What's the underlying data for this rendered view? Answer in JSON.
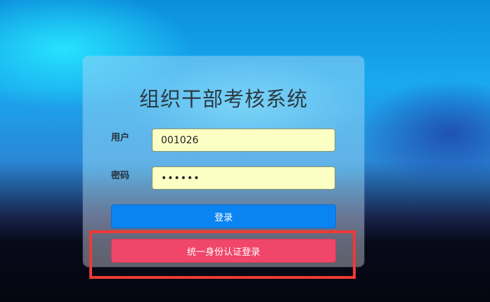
{
  "login": {
    "title": "组织干部考核系统",
    "username_label": "用户",
    "username_value": "001026",
    "password_label": "密码",
    "password_value": "123456",
    "login_button": "登录",
    "sso_button": "统一身份认证登录"
  },
  "colors": {
    "login_button": "#0a84f0",
    "sso_button": "#f0466a",
    "input_background": "#fbffc4",
    "highlight_border": "#ee3a35"
  }
}
